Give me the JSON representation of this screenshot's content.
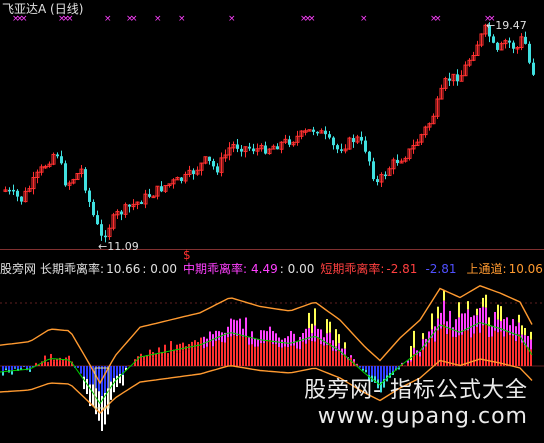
{
  "header": {
    "title": "飞亚达A (日线)"
  },
  "price_chart": {
    "high_label": "19.47",
    "low_label": "11.09",
    "signal_mark": "$"
  },
  "indicator": {
    "name": "股旁网",
    "long_label": "长期乖离率:",
    "long_value": "10.66",
    "long_zero": ": 0.00",
    "mid_label": "中期乖离率:",
    "mid_value": "4.49",
    "mid_zero": ": 0.00",
    "short_label": "短期乖离率:",
    "short_value1": "-2.81",
    "short_value2": "-2.81",
    "upper_label": "上通道:",
    "upper_value": "10.06"
  },
  "watermark": {
    "line1": "股旁网- 指标公式大全",
    "line2": "www.gupang.com"
  },
  "colors": {
    "up": "#ff3030",
    "down": "#40e0e0",
    "mid_bar": "#ff40ff",
    "long_bar": "#ffff55",
    "channel": "#ff9a30",
    "neg_bar": "#3040ff"
  },
  "chart_data": {
    "type": "candlestick",
    "title": "飞亚达A (日线)",
    "marked_high": 19.47,
    "marked_low": 11.09,
    "ylim": [
      10.5,
      20.0
    ]
  }
}
